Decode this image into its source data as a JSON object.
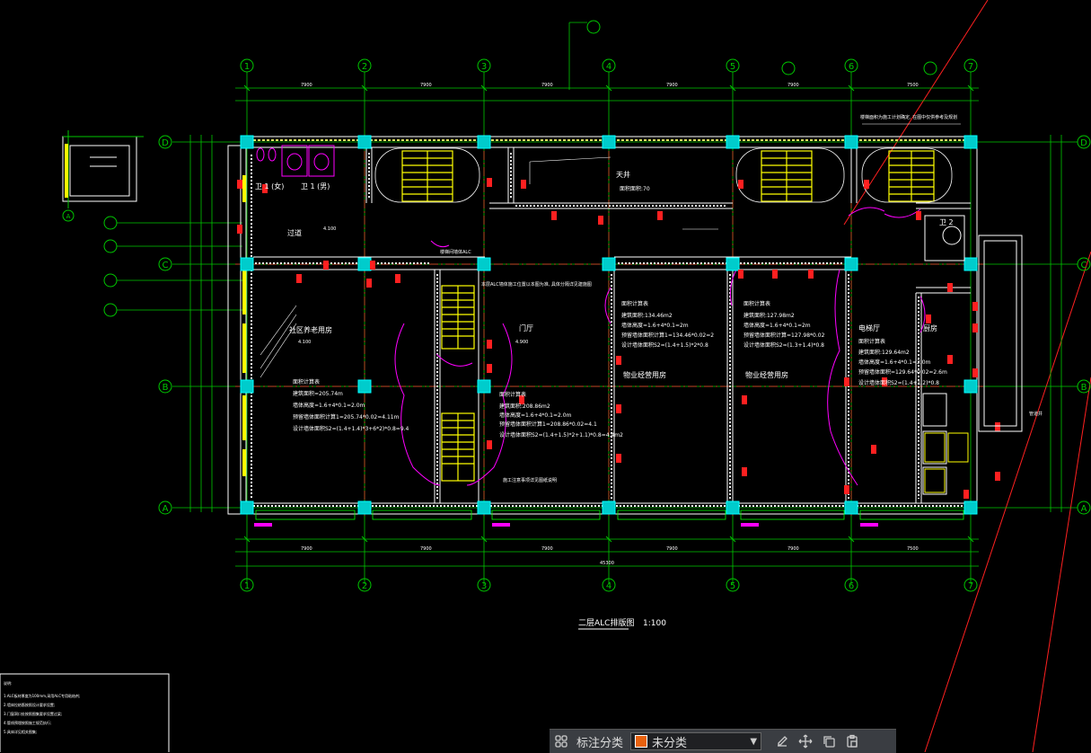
{
  "drawing": {
    "axes_top": [
      "1",
      "2",
      "3",
      "4",
      "5",
      "6",
      "7"
    ],
    "axes_left": [
      "D",
      "C",
      "B",
      "A"
    ],
    "axes_detail": [
      "A"
    ],
    "room_labels": {
      "wc_female": "卫 1 (女)",
      "wc_male": "卫 1 (男)",
      "corridor": "过道",
      "community_room": "社区养老用房",
      "atrium": "天井",
      "atrium_area": "面积面积:70",
      "door_hall": "门厅",
      "property_room_1": "物业经营用房",
      "property_room_2": "物业经营用房",
      "electric_room": "电梯厅",
      "kitchen": "厨房",
      "wc_right": "卫 2",
      "elevation_1": "4.100",
      "elevation_2": "4.100",
      "elevation_3": "4.900"
    },
    "calc_blocks": {
      "community": [
        "面积计算表",
        "建筑面积=205.74m",
        "墙体高度=1.6+4*0.1=2.0m",
        "预留墙体面积计算1=205.74*0.02=4.11m",
        "设计墙体面积S2=(1.4+1.4)*3+6*2)*0.8=9.4"
      ],
      "hall": [
        "面积计算表",
        "建筑面积:208.86m2",
        "墙体高度=1.6+4*0.1=2.0m",
        "预留墙体面积计算1=208.86*0.02=4.1",
        "设计墙体面积S2=(1.4+1.5)*2+1.1)*0.8=4.4m2"
      ],
      "property1": [
        "面积计算表",
        "建筑面积:134.46m2",
        "墙体高度=1.6+4*0.1=2m",
        "预留墙体面积计算1=134.46*0.02=2",
        "设计墙体面积S2=(1.4+1.5)*2*0.8"
      ],
      "property2": [
        "面积计算表",
        "建筑面积:127.98m2",
        "墙体高度=1.6+4*0.1=2m",
        "预留墙体面积计算=127.98*0.02",
        "设计墙体面积S2=(1.3+1.4)*0.8"
      ],
      "electric": [
        "面积计算表",
        "建筑面积:129.64m2",
        "墙体高度=1.6+4*0.1=2.0m",
        "预留墙体面积=129.64*0.02=2.6m",
        "设计墙体面积S2=(1.4+1.2)*0.8"
      ]
    },
    "notes": {
      "top_right": "楼梯面积为施工计划确定, 在图中仅供参考及规划",
      "hall_note": "本层ALC墙体施工位置以本图为准, 具体分隔详见建施图",
      "stair_note": "楼梯间墙体ALC",
      "bottom_note": "施工注意事项详见图纸说明",
      "right_side_note": "管道井"
    },
    "title": "二层ALC排版图",
    "scale": "1:100",
    "dims_top": [
      "7900",
      "7900",
      "7900",
      "7900",
      "7900",
      "7500"
    ],
    "dims_total": "45300",
    "legend_lines": [
      "说明:",
      "1.ALC板材厚度为100mm,采用ALC专用粘结剂;",
      "2.墙体拉结筋按照设计要求设置;",
      "3.门窗洞口处按照图集要求设置过梁;",
      "4.管线预埋按照施工规范执行;",
      "5.具体详见相关图集;"
    ]
  },
  "toolbar": {
    "grid_icon": "grid-icon",
    "label": "标注分类",
    "selected_value": "未分类",
    "swatch_color": "#e8620e",
    "icons": [
      "edit-icon",
      "move-icon",
      "copy-icon",
      "paste-icon"
    ]
  },
  "colors": {
    "background": "#000000",
    "axis": "#00ff00",
    "wall": "#ffffff",
    "column": "#00ffff",
    "stair": "#ffff00",
    "door": "#ff00ff",
    "red": "#ff2020"
  }
}
